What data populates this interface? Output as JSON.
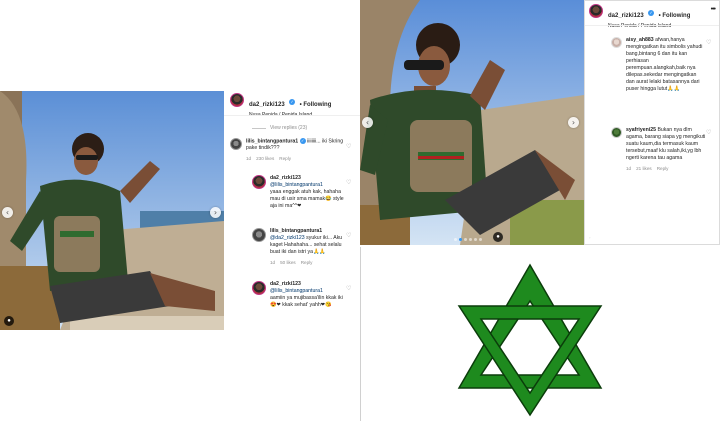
{
  "left_post": {
    "username": "da2_rizki123",
    "following": "• Following",
    "location": "Nusa Penida / Penida Island",
    "view_replies": "View replies (23)",
    "comments": [
      {
        "user": "lilis_bintangpantura1",
        "text": "iiiiiiii... iki Skring pake tindik???",
        "time": "1d",
        "likes": "230 likes",
        "reply": "Reply"
      },
      {
        "user": "da2_rizki123",
        "mention": "@lilis_bintangpantura1",
        "text": "yaaa enggak atuh kak, hahaha mau di usir sma mamak😂 style aja ini ma^^❤",
        "time": "",
        "likes": "",
        "reply": ""
      },
      {
        "user": "lilis_bintangpantura1",
        "mention": "@da2_rizki123",
        "text": "syukur iki... Aku kaget Hahahaha... sehat selalu buat iki dan istri ya🙏🙏",
        "time": "1d",
        "likes": "50 likes",
        "reply": "Reply"
      },
      {
        "user": "da2_rizki123",
        "mention": "@lilis_bintangpantura1",
        "text": "aamiin ya mujibassa'ilin kkak iki😍❤ kkak sehat' yahh❤😘",
        "time": "",
        "likes": "",
        "reply": ""
      }
    ]
  },
  "right_post": {
    "username": "da2_rizki123",
    "following": "• Following",
    "location": "Nusa Penida / Penida Island",
    "comments": [
      {
        "user": "aisy_ah883",
        "text": "afwan,hanya mengingatkan itu simbolis yahudi bang,bintang 6 dan itu kan perhiasan perempuan.alangkah,baik nya dilepas.sekedar mengingatkan dan aurat lelaki batasannya dari puser hingga lutut🙏🙏",
        "time": "",
        "likes": "",
        "reply": ""
      },
      {
        "user": "syafriyeni25",
        "text": "Bukan nya dlm agama, barang siapa yg mengikuti suatu kaum,dia termasuk kaum tersebut,maaf klu salah,iki,yg lbh ngerti karena tau agama",
        "time": "1d",
        "likes": "21 likes",
        "reply": "Reply"
      }
    ]
  },
  "icons": {
    "heart": "♡",
    "more": "•••",
    "arrow_left": "‹",
    "arrow_right": "›"
  },
  "colors": {
    "star_green": "#1e8a1e",
    "star_outline": "#0b3d0b",
    "link_blue": "#00376b",
    "verified_blue": "#3897f0"
  }
}
